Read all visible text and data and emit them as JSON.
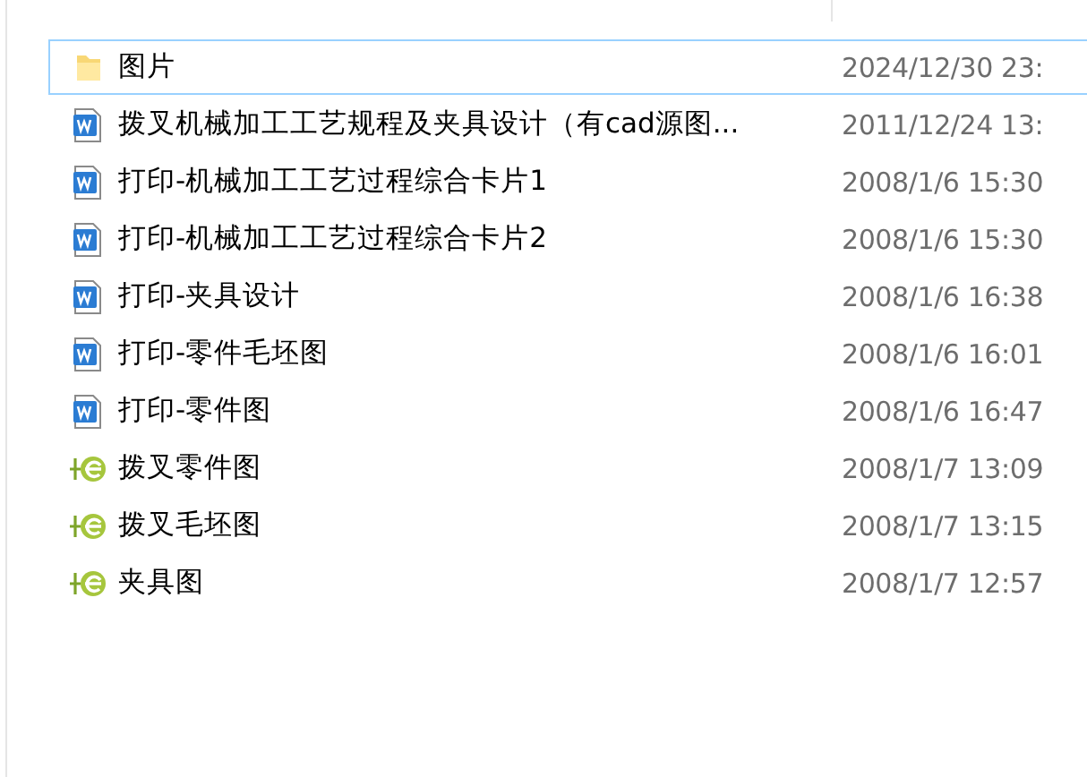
{
  "files": [
    {
      "name": "图片",
      "date": "2024/12/30 23:",
      "kind": "folder",
      "selected": true
    },
    {
      "name": "拨叉机械加工工艺规程及夹具设计（有cad源图...",
      "date": "2011/12/24 13:",
      "kind": "word",
      "selected": false
    },
    {
      "name": "打印-机械加工工艺过程综合卡片1",
      "date": "2008/1/6 15:30",
      "kind": "word",
      "selected": false
    },
    {
      "name": "打印-机械加工工艺过程综合卡片2",
      "date": "2008/1/6 15:30",
      "kind": "word",
      "selected": false
    },
    {
      "name": "打印-夹具设计",
      "date": "2008/1/6 16:38",
      "kind": "word",
      "selected": false
    },
    {
      "name": "打印-零件毛坯图",
      "date": "2008/1/6 16:01",
      "kind": "word",
      "selected": false
    },
    {
      "name": "打印-零件图",
      "date": "2008/1/6 16:47",
      "kind": "word",
      "selected": false
    },
    {
      "name": "拨叉零件图",
      "date": "2008/1/7 13:09",
      "kind": "drawing",
      "selected": false
    },
    {
      "name": "拨叉毛坯图",
      "date": "2008/1/7 13:15",
      "kind": "drawing",
      "selected": false
    },
    {
      "name": "夹具图",
      "date": "2008/1/7 12:57",
      "kind": "drawing",
      "selected": false
    }
  ]
}
